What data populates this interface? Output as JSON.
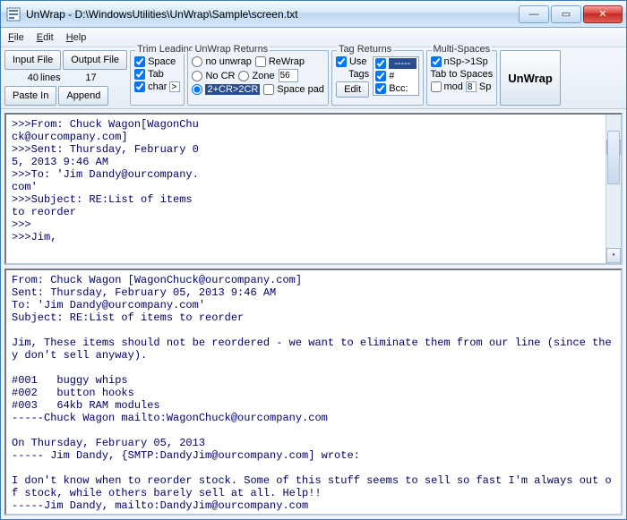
{
  "window": {
    "title": "UnWrap - D:\\WindowsUtilities\\UnWrap\\Sample\\screen.txt"
  },
  "menu": {
    "file": "File",
    "edit": "Edit",
    "help": "Help"
  },
  "toolbar": {
    "input_file": "Input File",
    "output_file": "Output File",
    "lines_count": "40",
    "lines_label": "lines",
    "other_count": "17",
    "paste_in": "Paste In",
    "append": "Append",
    "trim": {
      "legend": "Trim Leading",
      "space": "Space",
      "tab": "Tab",
      "char": "char",
      "char_val": ">"
    },
    "unwrap": {
      "legend": "UnWrap Returns",
      "no_unwrap": "no unwrap",
      "rewrap": "ReWrap",
      "no_cr": "No CR",
      "zone": "Zone",
      "zone_val": "56",
      "twocr": "2+CR>2CR",
      "spacepad": "Space pad"
    },
    "tag": {
      "legend": "Tag Returns",
      "use": "Use",
      "tags": "Tags",
      "edit": "Edit",
      "opt1": "-----",
      "opt2": "#",
      "opt3": "Bcc:"
    },
    "multi": {
      "legend": "Multi-Spaces",
      "nsp": "nSp->1Sp",
      "tab_to_spaces": "Tab to Spaces",
      "mod": "mod",
      "mod_val": "8",
      "sp": "Sp"
    },
    "go": "UnWrap"
  },
  "input_text": ">>>From: Chuck Wagon[WagonChu\nck@ourcompany.com]\n>>>Sent: Thursday, February 0\n5, 2013 9:46 AM\n>>>To: 'Jim Dandy@ourcompany.\ncom'\n>>>Subject: RE:List of items\nto reorder\n>>>\n>>>Jim,",
  "output_text": "From: Chuck Wagon [WagonChuck@ourcompany.com]\nSent: Thursday, February 05, 2013 9:46 AM\nTo: 'Jim Dandy@ourcompany.com'\nSubject: RE:List of items to reorder\n\nJim, These items should not be reordered - we want to eliminate them from our line (since they don't sell anyway).\n\n#001   buggy whips\n#002   button hooks\n#003   64kb RAM modules\n-----Chuck Wagon mailto:WagonChuck@ourcompany.com\n\nOn Thursday, February 05, 2013\n----- Jim Dandy, {SMTP:DandyJim@ourcompany.com] wrote:\n\nI don't know when to reorder stock. Some of this stuff seems to sell so fast I'm always out of stock, while others barely sell at all. Help!!\n-----Jim Dandy, mailto:DandyJim@ourcompany.com"
}
